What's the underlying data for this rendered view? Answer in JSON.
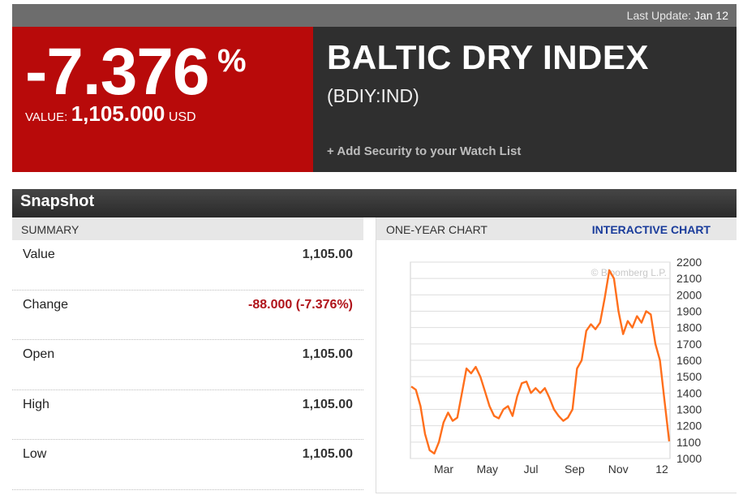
{
  "header": {
    "last_update_label": "Last Update:",
    "last_update_date": "Jan 12"
  },
  "quote": {
    "change_pct": "-7.376",
    "pct_sign": "%",
    "value_label": "VALUE:",
    "value": "1,105.000",
    "currency": "USD",
    "name": "BALTIC DRY INDEX",
    "ticker": "(BDIY:IND)",
    "watchlist_label": "+ Add Security to your Watch List"
  },
  "snapshot": {
    "title": "Snapshot",
    "summary_label": "SUMMARY",
    "rows": [
      {
        "label": "Value",
        "value": "1,105.00"
      },
      {
        "label": "Change",
        "value": "-88.000 (-7.376%)"
      },
      {
        "label": "Open",
        "value": "1,105.00"
      },
      {
        "label": "High",
        "value": "1,105.00"
      },
      {
        "label": "Low",
        "value": "1,105.00"
      }
    ]
  },
  "chart_panel": {
    "title": "ONE-YEAR CHART",
    "interactive_label": "INTERACTIVE CHART",
    "watermark": "© Bloomberg L.P."
  },
  "colors": {
    "accent_red": "#b80a0a",
    "series": "#ff6f1c",
    "link": "#1a3c9b"
  },
  "chart_data": {
    "type": "line",
    "title": "",
    "xlabel": "",
    "ylabel": "",
    "x_ticks": [
      "Mar",
      "May",
      "Jul",
      "Sep",
      "Nov",
      "12"
    ],
    "y_ticks": [
      1000,
      1100,
      1200,
      1300,
      1400,
      1500,
      1600,
      1700,
      1800,
      1900,
      2000,
      2100,
      2200
    ],
    "ylim": [
      1000,
      2200
    ],
    "grid": true,
    "series": [
      {
        "values": [
          1440,
          1420,
          1320,
          1150,
          1050,
          1030,
          1100,
          1220,
          1280,
          1230,
          1250,
          1400,
          1550,
          1520,
          1560,
          1500,
          1410,
          1320,
          1260,
          1245,
          1300,
          1320,
          1260,
          1380,
          1460,
          1470,
          1400,
          1430,
          1400,
          1430,
          1370,
          1300,
          1260,
          1230,
          1250,
          1300,
          1550,
          1600,
          1780,
          1820,
          1790,
          1830,
          1980,
          2150,
          2100,
          1900,
          1760,
          1840,
          1800,
          1870,
          1830,
          1900,
          1880,
          1700,
          1600,
          1350,
          1105
        ]
      }
    ]
  }
}
